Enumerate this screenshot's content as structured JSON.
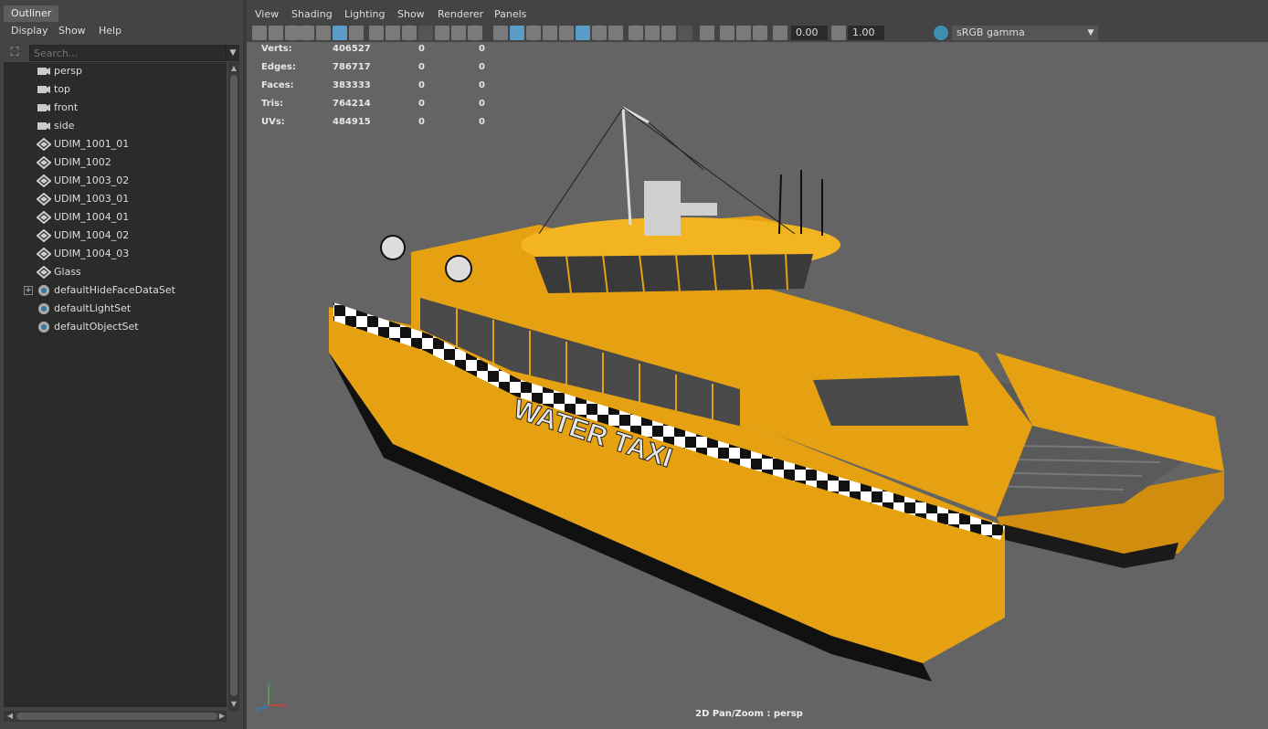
{
  "outliner": {
    "tab_label": "Outliner",
    "menu": [
      "Display",
      "Show",
      "Help"
    ],
    "search_placeholder": "Search...",
    "items": [
      {
        "label": "persp",
        "icon": "camera-icon"
      },
      {
        "label": "top",
        "icon": "camera-icon"
      },
      {
        "label": "front",
        "icon": "camera-icon"
      },
      {
        "label": "side",
        "icon": "camera-icon"
      },
      {
        "label": "UDIM_1001_01",
        "icon": "mesh-icon"
      },
      {
        "label": "UDIM_1002",
        "icon": "mesh-icon"
      },
      {
        "label": "UDIM_1003_02",
        "icon": "mesh-icon"
      },
      {
        "label": "UDIM_1003_01",
        "icon": "mesh-icon"
      },
      {
        "label": "UDIM_1004_01",
        "icon": "mesh-icon"
      },
      {
        "label": "UDIM_1004_02",
        "icon": "mesh-icon"
      },
      {
        "label": "UDIM_1004_03",
        "icon": "mesh-icon"
      },
      {
        "label": "Glass",
        "icon": "mesh-icon"
      },
      {
        "label": "defaultHideFaceDataSet",
        "icon": "set-icon",
        "expandable": true
      },
      {
        "label": "defaultLightSet",
        "icon": "set-icon"
      },
      {
        "label": "defaultObjectSet",
        "icon": "set-icon"
      }
    ]
  },
  "viewport": {
    "menu": [
      "View",
      "Shading",
      "Lighting",
      "Show",
      "Renderer",
      "Panels"
    ],
    "exposure_value": "0.00",
    "gamma_value": "1.00",
    "color_space": "sRGB gamma",
    "hud": [
      {
        "label": "Verts:",
        "v0": "406527",
        "v1": "0",
        "v2": "0"
      },
      {
        "label": "Edges:",
        "v0": "786717",
        "v1": "0",
        "v2": "0"
      },
      {
        "label": "Faces:",
        "v0": "383333",
        "v1": "0",
        "v2": "0"
      },
      {
        "label": "Tris:",
        "v0": "764214",
        "v1": "0",
        "v2": "0"
      },
      {
        "label": "UVs:",
        "v0": "484915",
        "v1": "0",
        "v2": "0"
      }
    ],
    "status": "2D Pan/Zoom : persp",
    "hull_text": "WATER TAXI",
    "colors": {
      "hull_yellow": "#e5a112",
      "hull_dark": "#1a1a1a",
      "canvas_bg": "#646464"
    }
  }
}
